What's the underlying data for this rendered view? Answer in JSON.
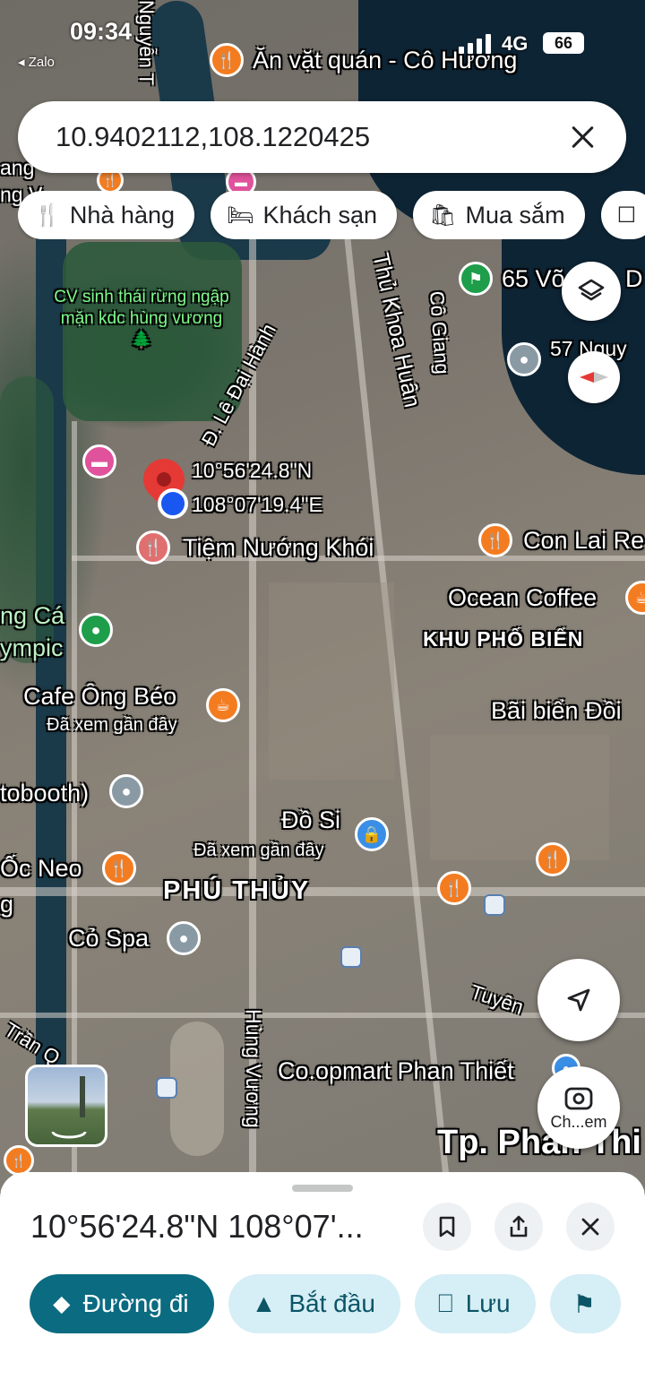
{
  "status_bar": {
    "time": "09:34",
    "back_app": "◂ Zalo",
    "network": "4G",
    "battery": "66"
  },
  "search": {
    "query": "10.9402112,108.1220425"
  },
  "chips": [
    {
      "icon": "restaurant-icon",
      "glyph": "🍴",
      "label": "Nhà hàng"
    },
    {
      "icon": "hotel-icon",
      "glyph": "🛏",
      "label": "Khách sạn"
    },
    {
      "icon": "shopping-icon",
      "glyph": "🛍",
      "label": "Mua sắm"
    },
    {
      "icon": "more-chip-icon",
      "glyph": "☐",
      "label": ""
    }
  ],
  "map": {
    "coord_lat": "10°56'24.8\"N",
    "coord_lng": "108°07'19.4\"E",
    "labels": {
      "top_poi": "Ăn vặt quán - Cô Hương",
      "nguyen": "Nguyễn T",
      "park": "CV sinh thái rừng ngập mặn kdc hùng vương 🌲",
      "le_dai_hanh": "Đ. Lê Đại Hành",
      "thu_khoa_huan": "Thủ Khoa Huân",
      "co_giang": "Cô Giang",
      "vo": "65 Võ",
      "vo2": "D",
      "nguy": "57 Nguy",
      "tiem": "Tiệm Nướng Khói",
      "con_lai": "Con Lai Re",
      "ocean": "Ocean Coffee",
      "khu_pho": "KHU PHỐ BIỂN",
      "ca": "ng Cá",
      "ympic": "ympic",
      "cafe": "Cafe Ông Béo",
      "cafe_sub": "Đã xem gần đây",
      "bai_bien": "Bãi biển Đồi",
      "booth": "tobooth)",
      "do_si": "Đồ Si",
      "do_si_sub": "Đã xem gần đây",
      "oc_neo": "Ốc Neo",
      "g": "g",
      "phu_thuy": "PHÚ THỦY",
      "co_spa": "Cỏ Spa",
      "tuyen": "Tuyên",
      "tran": "Trần Q",
      "hung_vuong": "Hùng Vương",
      "coopmart": "Co.opmart Phan Thiết",
      "tp": "Tp. Phan Thi",
      "ang": "ang",
      "ng": "ng V"
    }
  },
  "controls": {
    "lens_label": "Ch...em"
  },
  "sheet": {
    "title": "10°56'24.8\"N 108°07'...",
    "actions": [
      {
        "icon": "directions-icon",
        "glyph": "⬥",
        "label": "Đường đi",
        "primary": true
      },
      {
        "icon": "start-icon",
        "glyph": "▲",
        "label": "Bắt đầu",
        "primary": false
      },
      {
        "icon": "save-icon",
        "glyph": "⎕",
        "label": "Lưu",
        "primary": false
      },
      {
        "icon": "flag-icon",
        "glyph": "⚑",
        "label": "",
        "primary": false
      }
    ]
  }
}
